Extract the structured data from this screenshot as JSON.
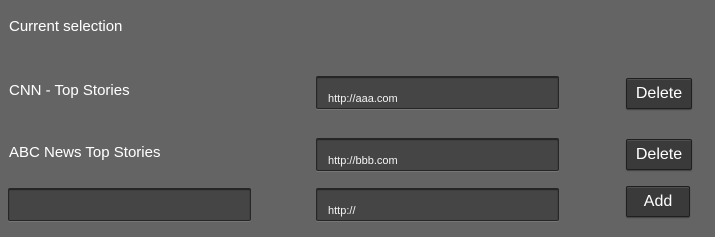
{
  "section": {
    "title": "Current selection"
  },
  "feeds": [
    {
      "name": "CNN - Top Stories",
      "url": "http://aaa.com",
      "action": "Delete"
    },
    {
      "name": "ABC News Top Stories",
      "url": "http://bbb.com",
      "action": "Delete"
    }
  ],
  "new_feed": {
    "name": "",
    "url": "http://",
    "action": "Add"
  }
}
